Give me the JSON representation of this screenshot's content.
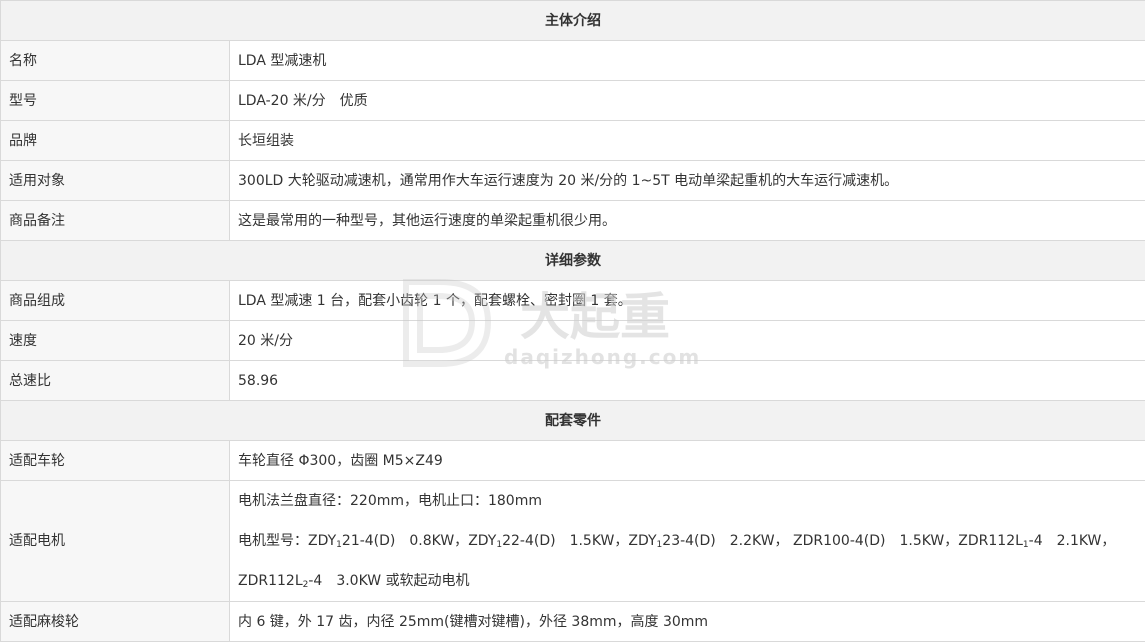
{
  "sections": {
    "intro": "主体介绍",
    "detail": "详细参数",
    "parts": "配套零件"
  },
  "intro_rows": [
    {
      "label": "名称",
      "value": "LDA 型减速机"
    },
    {
      "label": "型号",
      "value": "LDA-20 米/分　优质"
    },
    {
      "label": "品牌",
      "value": "长垣组装"
    },
    {
      "label": "适用对象",
      "value": "300LD 大轮驱动减速机，通常用作大车运行速度为 20 米/分的 1~5T 电动单梁起重机的大车运行减速机。"
    },
    {
      "label": "商品备注",
      "value": "这是最常用的一种型号，其他运行速度的单梁起重机很少用。"
    }
  ],
  "detail_rows": [
    {
      "label": "商品组成",
      "value": "LDA 型减速 1 台，配套小齿轮 1 个，配套螺栓、密封圈 1 套。"
    },
    {
      "label": "速度",
      "value": "20 米/分"
    },
    {
      "label": "总速比",
      "value": "58.96"
    }
  ],
  "parts_rows": {
    "wheel": {
      "label": "适配车轮",
      "value": "车轮直径 Φ300，齿圈 M5×Z49"
    },
    "motor": {
      "label": "适配电机",
      "flange": "电机法兰盘直径：220mm，电机止口：180mm",
      "models": [
        {
          "name": "ZDY",
          "sub": "1",
          "rest": "21-4(D)",
          "power": "0.8KW"
        },
        {
          "name": "ZDY",
          "sub": "1",
          "rest": "22-4(D)",
          "power": "1.5KW"
        },
        {
          "name": "ZDY",
          "sub": "1",
          "rest": "23-4(D)",
          "power": "2.2KW"
        },
        {
          "name": "ZDR100-4(D)",
          "sub": "",
          "rest": "",
          "power": "1.5KW"
        },
        {
          "name": "ZDR112L",
          "sub": "1",
          "rest": "-4",
          "power": "2.1KW"
        },
        {
          "name": "ZDR112L",
          "sub": "2",
          "rest": "-4",
          "power": "3.0KW"
        }
      ],
      "models_prefix": "电机型号：",
      "models_suffix": "或软起动电机"
    },
    "sprocket": {
      "label": "适配麻梭轮",
      "value": "内 6 键，外 17 齿，内径 25mm(键槽对键槽)，外径 38mm，高度 30mm"
    }
  },
  "watermark": {
    "text_cn": "大起重",
    "text_en": "daqizhong.com",
    "color": "#c8c8c8"
  }
}
